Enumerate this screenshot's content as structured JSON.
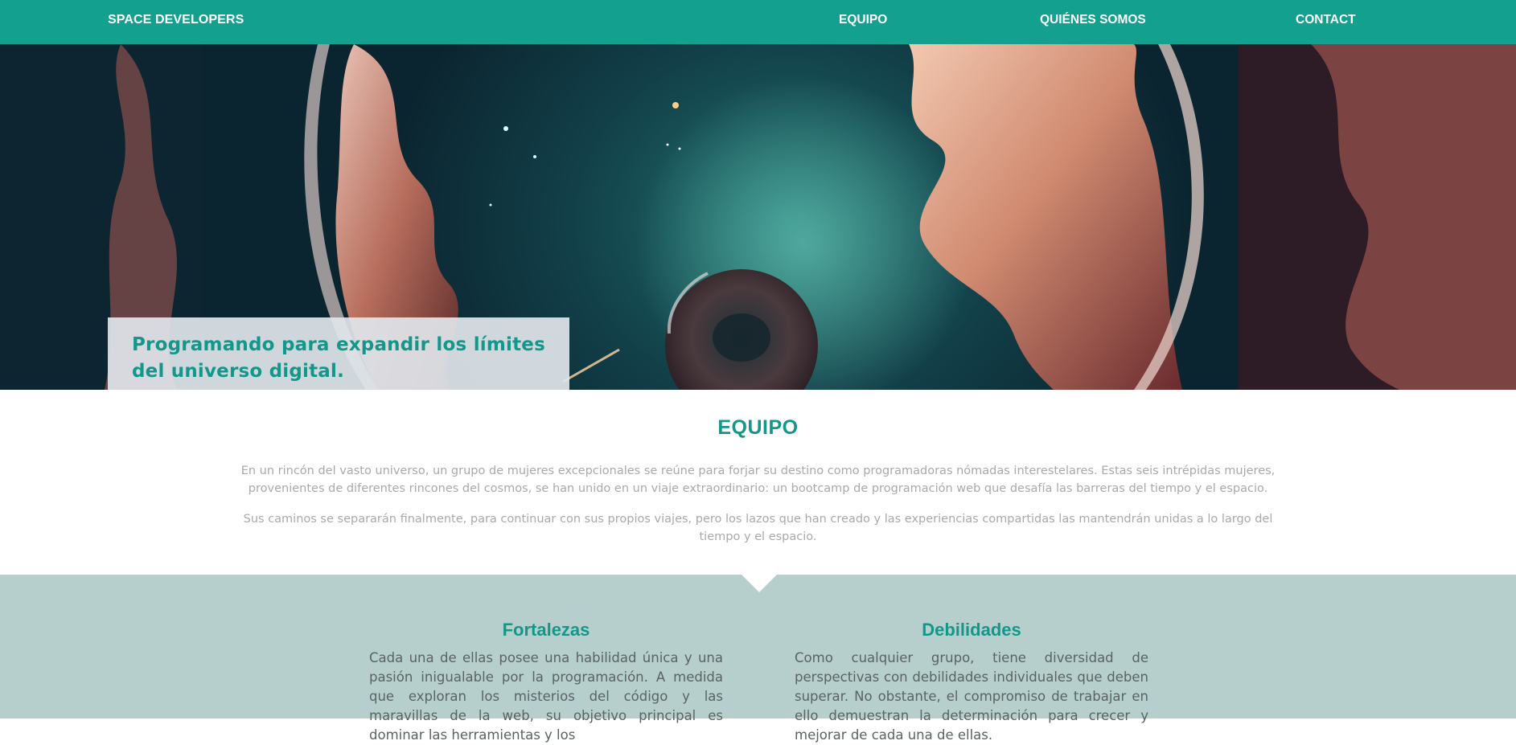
{
  "nav": {
    "brand": "SPACE DEVELOPERS",
    "links": [
      "EQUIPO",
      "QUIÉNES SOMOS",
      "CONTACT"
    ]
  },
  "hero": {
    "caption": "Programando para expandir los límites del universo digital."
  },
  "equipo": {
    "title": "EQUIPO",
    "paragraphs": [
      "En un rincón del vasto universo, un grupo de mujeres excepcionales se reúne para forjar su destino como programadoras nómadas interestelares. Estas seis intrépidas mujeres, provenientes de diferentes rincones del cosmos, se han unido en un viaje extraordinario: un bootcamp de programación web que desafía las barreras del tiempo y el espacio.",
      "Sus caminos se separarán finalmente, para continuar con sus propios viajes, pero los lazos que han creado y las experiencias compartidas las mantendrán unidas a lo largo del tiempo y el espacio."
    ]
  },
  "features": {
    "fortalezas": {
      "title": "Fortalezas",
      "text": "Cada una de ellas posee una habilidad única y una pasión inigualable por la programación. A medida que exploran los misterios del código y las maravillas de la web, su objetivo principal es dominar las herramientas y los"
    },
    "debilidades": {
      "title": "Debilidades",
      "text": "Como cualquier grupo, tiene diversidad de perspectivas con debilidades individuales que deben superar. No obstante, el compromiso de trabajar en ello demuestran la determinación para crecer y mejorar de cada una de ellas."
    }
  },
  "colors": {
    "accent": "#13a08e",
    "bottom_bg": "#b7cfcc"
  }
}
